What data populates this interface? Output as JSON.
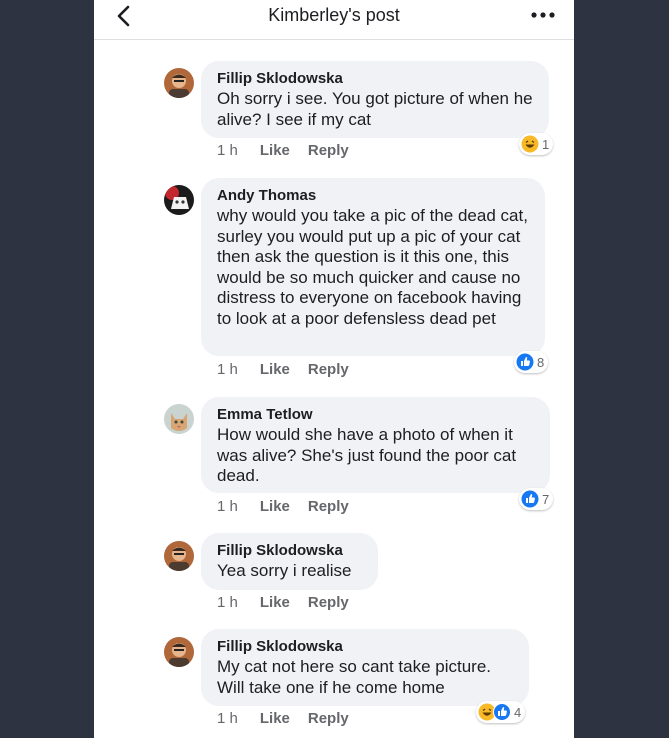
{
  "header": {
    "title": "Kimberley's post"
  },
  "colors": {
    "like_blue": "#1877f2",
    "haha_yellow": "#f7b928",
    "bubble_bg": "#f0f2f5"
  },
  "comments": [
    {
      "author": "Fillip Sklodowska",
      "text": "Oh sorry i see. You got picture of when he alive? I see if my cat",
      "time": "1 h",
      "like": "Like",
      "reply": "Reply",
      "reactions": [
        "haha"
      ],
      "reaction_count": "1"
    },
    {
      "author": "Andy Thomas",
      "text": "why would you take a pic of the dead cat, surley you would put up a pic of your cat then ask the question is it this one, this would be so much quicker and cause no distress to everyone on facebook having to look at a poor defensless dead pet",
      "time": "1 h",
      "like": "Like",
      "reply": "Reply",
      "reactions": [
        "like"
      ],
      "reaction_count": "8"
    },
    {
      "author": "Emma Tetlow",
      "text": "How would she have a photo of when it was alive? She's just found the poor cat dead.",
      "time": "1 h",
      "like": "Like",
      "reply": "Reply",
      "reactions": [
        "like"
      ],
      "reaction_count": "7"
    },
    {
      "author": "Fillip Sklodowska",
      "text": "Yea sorry i realise",
      "time": "1 h",
      "like": "Like",
      "reply": "Reply",
      "reactions": [],
      "reaction_count": ""
    },
    {
      "author": "Fillip Sklodowska",
      "text": "My cat not here so cant take picture. Will take one if he come home",
      "time": "1 h",
      "like": "Like",
      "reply": "Reply",
      "reactions": [
        "haha",
        "like"
      ],
      "reaction_count": "4"
    }
  ]
}
